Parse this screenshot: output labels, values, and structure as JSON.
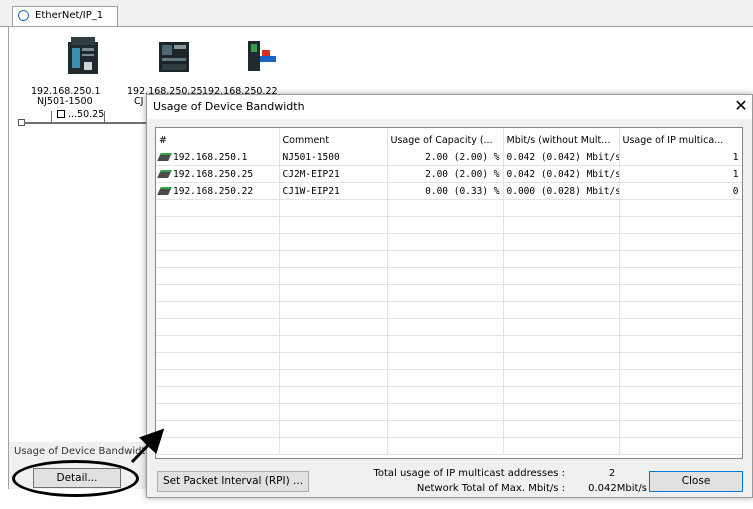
{
  "tab": {
    "label": "EtherNet/IP_1"
  },
  "devices": [
    {
      "ip": "192.168.250.1",
      "model": "NJ501-1500"
    },
    {
      "ip": "192.168.250.25",
      "model": "CJ"
    },
    {
      "ip": "192.168.250.22"
    }
  ],
  "node_box_label": "...50.25",
  "bandwidth_panel": {
    "title": "Usage of Device Bandwidth",
    "detail_button": "Detail..."
  },
  "dialog": {
    "title": "Usage of Device Bandwidth",
    "close_glyph": "✕",
    "columns": [
      "#",
      "Comment",
      "Usage of Capacity (...",
      "Mbit/s (without Mult...",
      "Usage of IP multica..."
    ],
    "rows": [
      {
        "ip": "192.168.250.1",
        "comment": "NJ501-1500",
        "capacity": "2.00 (2.00) %",
        "mbits": "0.042 (0.042) Mbit/s",
        "multicast": "1"
      },
      {
        "ip": "192.168.250.25",
        "comment": "CJ2M-EIP21",
        "capacity": "2.00 (2.00) %",
        "mbits": "0.042 (0.042) Mbit/s",
        "multicast": "1"
      },
      {
        "ip": "192.168.250.22",
        "comment": "CJ1W-EIP21",
        "capacity": "0.00 (0.33) %",
        "mbits": "0.000 (0.028) Mbit/s",
        "multicast": "0"
      }
    ],
    "set_packet_button": "Set Packet Interval (RPI) ...",
    "total_multicast_label": "Total usage of IP multicast addresses :",
    "total_multicast_value": "2",
    "network_total_label": "Network Total of Max. Mbit/s :",
    "network_total_value": "0.042Mbit/s",
    "close_button": "Close"
  }
}
